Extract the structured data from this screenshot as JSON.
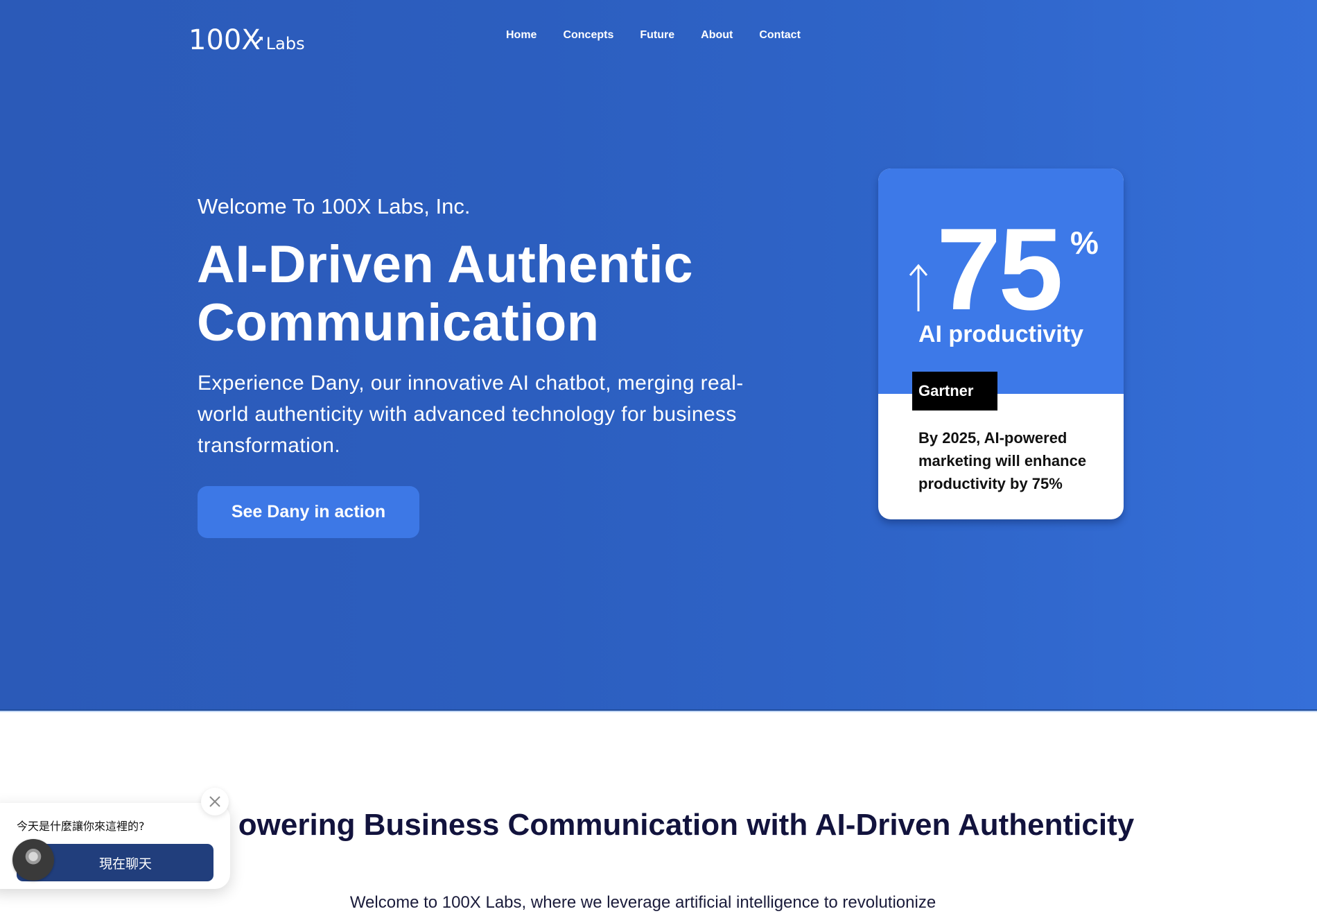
{
  "header": {
    "logo_main": "100X",
    "logo_sub": "Labs",
    "nav": [
      {
        "label": "Home"
      },
      {
        "label": "Concepts"
      },
      {
        "label": "Future"
      },
      {
        "label": "About"
      },
      {
        "label": "Contact"
      }
    ]
  },
  "hero": {
    "eyebrow": "Welcome To 100X Labs, Inc.",
    "headline": "AI-Driven Authentic Communication",
    "subtext": "Experience Dany, our innovative AI chatbot, merging real-world authenticity with advanced technology for business transformation.",
    "cta_label": "See Dany in action"
  },
  "stat_card": {
    "arrow_icon": "arrow-up-icon",
    "number": "75",
    "unit": "%",
    "label": "AI productivity",
    "source": "Gartner",
    "description": "By 2025, AI-powered marketing will enhance productivity by 75%"
  },
  "section": {
    "title": "Empowering Business Communication with AI-Driven Authenticity",
    "visible_title": "owering Business Communication with AI-Driven Authenticity",
    "intro": "Welcome to 100X Labs, where we leverage artificial intelligence to revolutionize"
  },
  "chat_widget": {
    "question": "今天是什麼讓你來這裡的?",
    "button_label": "現在聊天",
    "close_icon": "close-icon"
  },
  "colors": {
    "hero_bg_start": "#2b5ab8",
    "hero_bg_end": "#356fd8",
    "accent": "#3d79e8",
    "chat_button": "#213e7c",
    "section_title": "#12133d"
  }
}
